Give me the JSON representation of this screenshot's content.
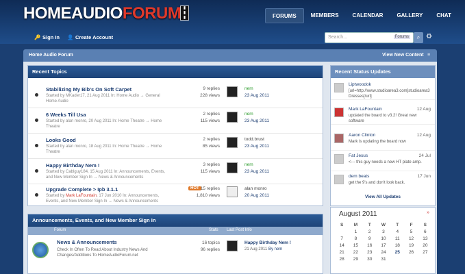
{
  "header": {
    "logo_part1": "HOMEAUDIO",
    "logo_part2": "FORUM",
    "nav": [
      "FORUMS",
      "MEMBERS",
      "CALENDAR",
      "GALLERY",
      "CHAT"
    ]
  },
  "subbar": {
    "signin": "Sign In",
    "create": "Create Account",
    "search_placeholder": "Search...",
    "search_scope": "Forums"
  },
  "breadcrumb": {
    "title": "Home Audio Forum",
    "view_new": "View New Content"
  },
  "recent_topics": {
    "title": "Recent Topics",
    "rows": [
      {
        "title": "Stabilizing My Bib's On Soft Carpet",
        "meta": "Started by MKader17, 21 Aug 2011 In: Home Audio → General Home Audio",
        "replies": "9 replies",
        "views": "228 views",
        "last": "nem",
        "date": "23 Aug 2011",
        "hot": ""
      },
      {
        "title": "6 Weeks Till Usa",
        "meta": "Started by alan monro, 20 Aug 2011 In: Home Theatre → Home Theatre",
        "replies": "2 replies",
        "views": "115 views",
        "last": "nem",
        "date": "23 Aug 2011",
        "hot": ""
      },
      {
        "title": "Looks Good",
        "meta": "Started by alan monro, 18 Aug 2011 In: Home Theatre → Home Theatre",
        "replies": "2 replies",
        "views": "85 views",
        "last": "todd.brust",
        "date": "23 Aug 2011",
        "hot": ""
      },
      {
        "title": "Happy Birthday Nem !",
        "meta": "Started by Cablguy184, 15 Aug 2011 In: Announcements, Events, and New Member Sign In → News & Announcements",
        "replies": "3 replies",
        "views": "115 views",
        "last": "nem",
        "date": "23 Aug 2011",
        "hot": ""
      },
      {
        "title": "Upgrade Complete > Ipb 3.1.1",
        "meta_pre": "Started by ",
        "meta_red": "Mark LaFountain",
        "meta_post": ", 17 Jun 2010 In: Announcements, Events, and New Member Sign In → News & Announcements",
        "replies": "15 replies",
        "views": "1,810 views",
        "last": "alan monro",
        "date": "20 Aug 2011",
        "hot": "HOT"
      }
    ]
  },
  "announcements": {
    "title": "Announcements, Events, and New Member Sign In",
    "h_forum": "Forum",
    "h_stats": "Stats",
    "h_last": "Last Post Info",
    "forum": "News & Announcements",
    "desc": "Check In Often To Read About Industry News And Changes/Additions To HomeAudioForum.net",
    "topics": "16 topics",
    "replies": "96 replies",
    "last_title": "Happy Birthday Nem !",
    "last_date": "21 Aug 2011",
    "last_by": "By nem"
  },
  "status": {
    "title": "Recent Status Updates",
    "rows": [
      {
        "name": "Liptwoodok",
        "date": "",
        "text": "[url=http://www.studioarea3.com]studioarea3 Dresses[/url]"
      },
      {
        "name": "Mark LaFountain",
        "date": "12 Aug",
        "text": "updated the board to v3.2! Great new software"
      },
      {
        "name": "Aaron Clinton",
        "date": "12 Aug",
        "text": "Mark is updating the board now"
      },
      {
        "name": "Fat Jesus",
        "date": "24 Jul",
        "text": "<--- this guy needs a new HT plate amp."
      },
      {
        "name": "dem beats",
        "date": "17 Jun",
        "text": "get the 9's and don't look back."
      }
    ],
    "view_all": "View All Updates"
  },
  "calendar": {
    "month": "August 2011",
    "days": [
      "S",
      "M",
      "T",
      "W",
      "T",
      "F",
      "S"
    ],
    "dates": [
      "",
      "1",
      "2",
      "3",
      "4",
      "5",
      "6",
      "7",
      "8",
      "9",
      "10",
      "11",
      "12",
      "13",
      "14",
      "15",
      "16",
      "17",
      "18",
      "19",
      "20",
      "21",
      "22",
      "23",
      "24",
      "25",
      "26",
      "27",
      "28",
      "29",
      "30",
      "31",
      "",
      "",
      ""
    ],
    "today": "25"
  }
}
